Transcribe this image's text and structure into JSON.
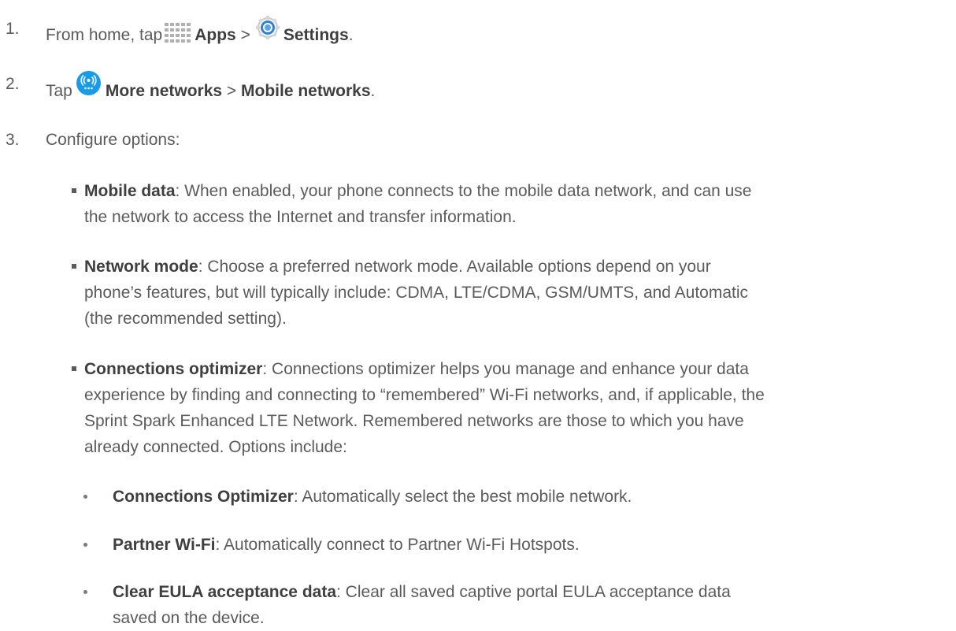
{
  "steps": [
    {
      "number": "1.",
      "parts": [
        "From home, tap",
        "Apps",
        ">",
        "Settings",
        "."
      ],
      "icons": [
        "apps-grid-icon",
        "settings-gear-icon"
      ]
    },
    {
      "number": "2.",
      "parts": [
        "Tap",
        "More networks",
        ">",
        "Mobile networks",
        "."
      ],
      "icons": [
        "more-networks-icon"
      ]
    },
    {
      "number": "3.",
      "text": "Configure options:"
    }
  ],
  "options": [
    {
      "term": "Mobile data",
      "line1": ": When enabled, your phone connects to the mobile data network, and can use",
      "line2": "the network to access the Internet and transfer information."
    },
    {
      "term": "Network mode",
      "line1": ": Choose a preferred network mode. Available options depend on your",
      "line2": "phone’s features, but will typically include: CDMA, LTE/CDMA, GSM/UMTS, and Automatic",
      "line3": "(the recommended setting)."
    },
    {
      "term": "Connections optimizer",
      "line1": ": Connections optimizer helps you manage and enhance your data",
      "line2": "experience by finding and connecting to “remembered” Wi-Fi networks, and, if applicable, the",
      "line3": "Sprint Spark Enhanced LTE Network. Remembered networks are those to which you have",
      "line4": "already connected. Options include:"
    }
  ],
  "sub_options": [
    {
      "term": "Connections Optimizer",
      "line1": ": Automatically select the best mobile network."
    },
    {
      "term": "Partner Wi-Fi",
      "line1": ": Automatically connect to Partner Wi-Fi Hotspots."
    },
    {
      "term": "Clear EULA acceptance data",
      "line1": ": Clear all saved captive portal EULA acceptance data",
      "line2": "saved on the device."
    }
  ],
  "colors": {
    "text": "#5b5b5b",
    "bold_text": "#3f3f3f",
    "network_icon_blue": "#1a9be8",
    "settings_icon_blue": "#2f7fd6"
  }
}
